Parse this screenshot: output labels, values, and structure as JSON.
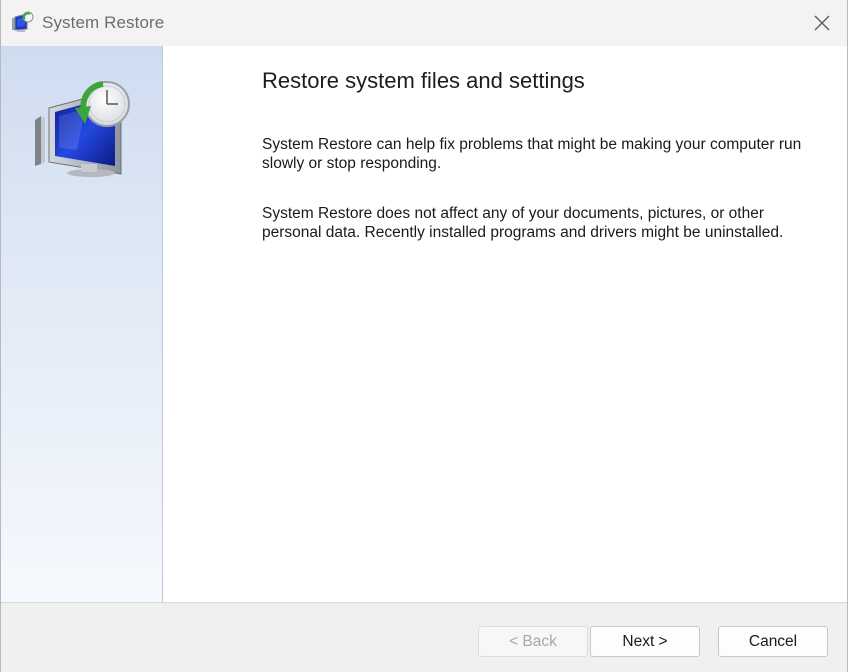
{
  "window": {
    "title": "System Restore",
    "icon": "system-restore-icon",
    "close_icon": "close-icon"
  },
  "sidebar": {
    "icon": "system-restore-monitor-clock-icon"
  },
  "main": {
    "heading": "Restore system files and settings",
    "paragraph1": "System Restore can help fix problems that might be making your computer run slowly or stop responding.",
    "paragraph2": "System Restore does not affect any of your documents, pictures, or other personal data. Recently installed programs and drivers might be uninstalled."
  },
  "footer": {
    "back_label": "< Back",
    "back_enabled": false,
    "next_label": "Next >",
    "cancel_label": "Cancel"
  },
  "colors": {
    "sidebar_top": "#cfdcf0",
    "sidebar_bottom": "#f6f9fd",
    "titlebar": "#f3f3f3",
    "footer": "#f0f0f0"
  }
}
